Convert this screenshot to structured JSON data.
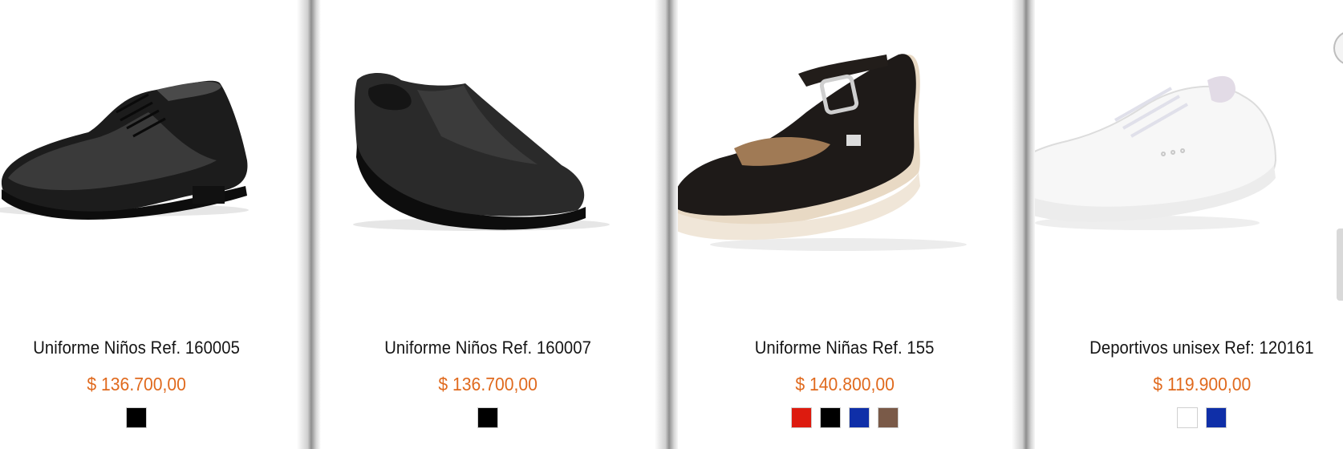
{
  "products": [
    {
      "name": "Uniforme Niños Ref. 160005",
      "price": "$ 136.700,00",
      "image_icon": "black-lace-up-shoe",
      "colors": [
        {
          "name": "black",
          "hex": "#000000"
        }
      ]
    },
    {
      "name": "Uniforme Niños Ref. 160007",
      "price": "$ 136.700,00",
      "image_icon": "black-slip-on-shoe",
      "colors": [
        {
          "name": "black",
          "hex": "#000000"
        }
      ]
    },
    {
      "name": "Uniforme Niñas Ref. 155",
      "price": "$ 140.800,00",
      "image_icon": "black-mary-jane-shoe",
      "colors": [
        {
          "name": "red",
          "hex": "#dd1b0f"
        },
        {
          "name": "black",
          "hex": "#000000"
        },
        {
          "name": "blue",
          "hex": "#0f2fa8"
        },
        {
          "name": "brown",
          "hex": "#7a5a48"
        }
      ]
    },
    {
      "name": "Deportivos unisex Ref: 120161",
      "price": "$ 119.900,00",
      "image_icon": "white-sneaker",
      "colors": [
        {
          "name": "white",
          "hex": "#ffffff"
        },
        {
          "name": "blue",
          "hex": "#0f2fa8"
        }
      ]
    }
  ],
  "theme": {
    "price_color": "#e06a1e",
    "name_color": "#141414"
  }
}
